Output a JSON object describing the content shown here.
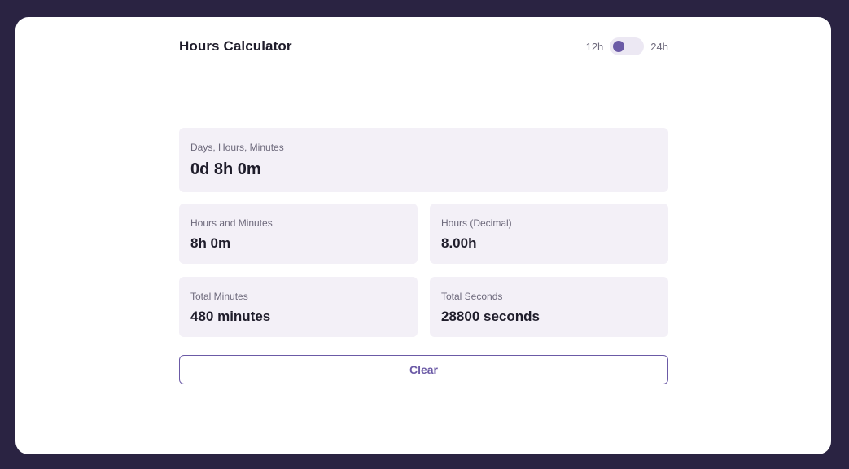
{
  "header": {
    "title": "Hours Calculator",
    "toggle": {
      "left_label": "12h",
      "right_label": "24h",
      "selected": "12h"
    }
  },
  "results": {
    "days_hours_minutes": {
      "label": "Days, Hours, Minutes",
      "value": "0d 8h 0m"
    },
    "hours_minutes": {
      "label": "Hours and Minutes",
      "value": "8h 0m"
    },
    "hours_decimal": {
      "label": "Hours (Decimal)",
      "value": "8.00h"
    },
    "total_minutes": {
      "label": "Total Minutes",
      "value": "480 minutes"
    },
    "total_seconds": {
      "label": "Total Seconds",
      "value": "28800 seconds"
    }
  },
  "actions": {
    "clear_label": "Clear"
  },
  "colors": {
    "background": "#2a2342",
    "card": "#ffffff",
    "accent": "#6b5aa6",
    "result_bg": "#f3f0f7"
  }
}
